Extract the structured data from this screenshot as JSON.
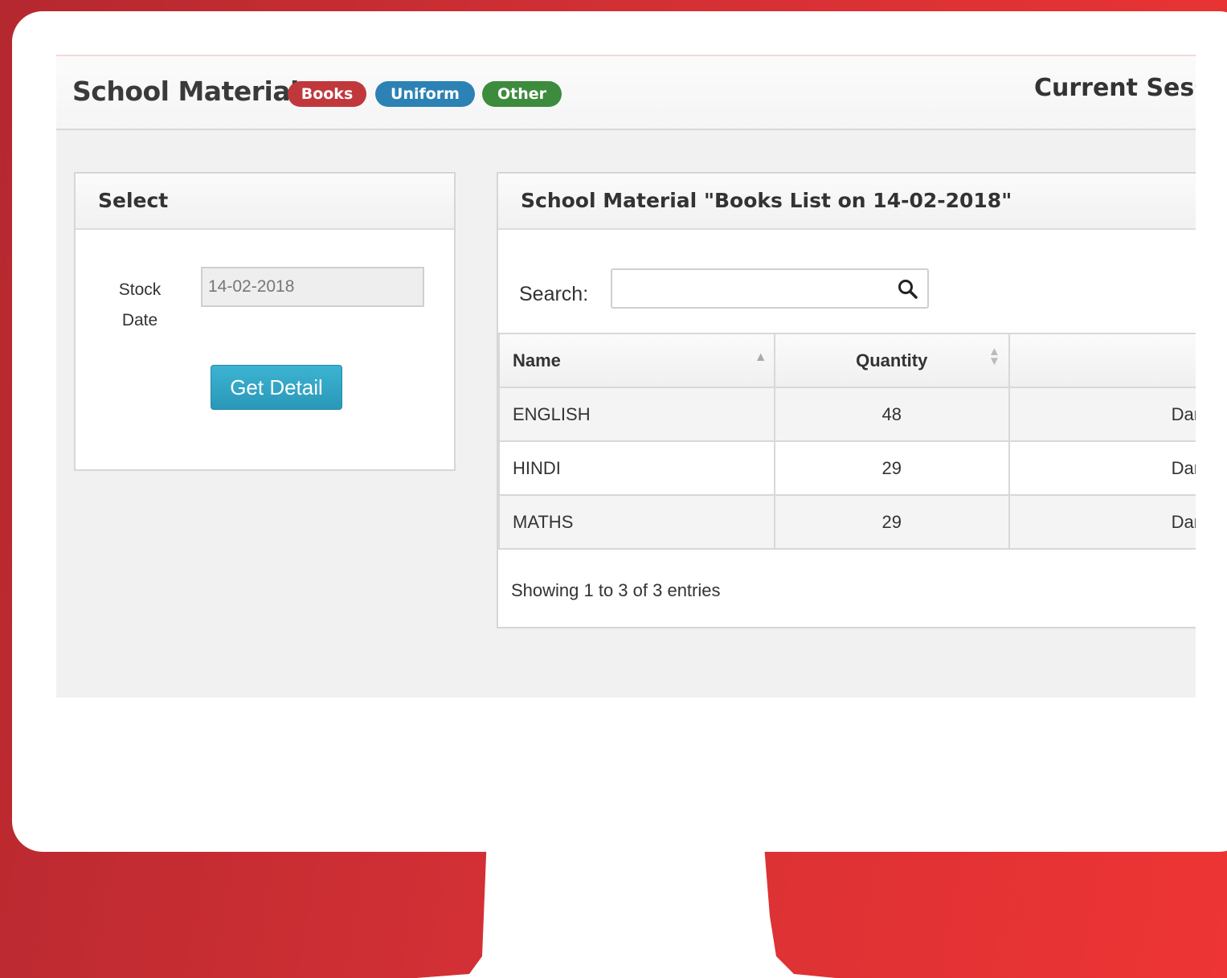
{
  "header": {
    "title": "School Material",
    "badges": [
      "Books",
      "Uniform",
      "Other"
    ],
    "session_label": "Current Sess"
  },
  "select_panel": {
    "title": "Select",
    "stock_date_label": "Stock Date",
    "stock_date_value": "14-02-2018",
    "get_detail_label": "Get Detail"
  },
  "list_panel": {
    "title": "School Material \"Books List on 14-02-2018\"",
    "search_label": "Search:",
    "columns": [
      "Name",
      "Quantity"
    ],
    "rows": [
      {
        "name": "ENGLISH",
        "quantity": "48",
        "status": "Dan"
      },
      {
        "name": "HINDI",
        "quantity": "29",
        "status": "Dan"
      },
      {
        "name": "MATHS",
        "quantity": "29",
        "status": "Dan"
      }
    ],
    "info": "Showing 1 to 3 of 3 entries"
  },
  "colors": {
    "badge_books": "#c0383c",
    "badge_uniform": "#2c82b4",
    "badge_other": "#3d8b3d",
    "button": "#31a5c6",
    "background_red": "#d23035"
  },
  "icons": {
    "search": "search-icon",
    "sort_asc": "sort-asc-icon",
    "sort_both": "sort-both-icon"
  }
}
